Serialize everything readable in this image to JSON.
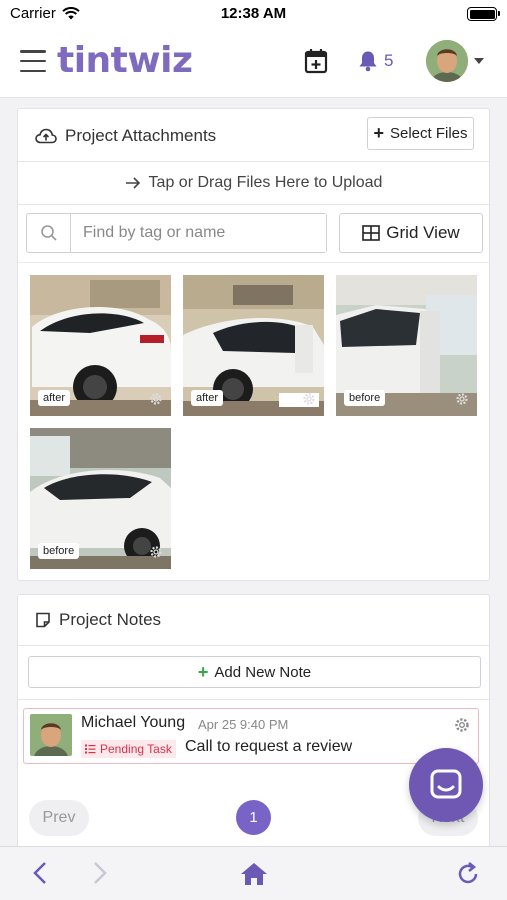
{
  "status_bar": {
    "carrier": "Carrier",
    "time": "12:38 AM"
  },
  "header": {
    "logo": "tintwiz",
    "notification_count": "5"
  },
  "attachments": {
    "title": "Project Attachments",
    "select_files_label": "Select Files",
    "dropzone_text": "Tap or Drag Files Here to Upload",
    "search_placeholder": "Find by tag or name",
    "grid_view_label": "Grid View",
    "photos": [
      {
        "tag": "after"
      },
      {
        "tag": "after"
      },
      {
        "tag": "before"
      },
      {
        "tag": "before"
      }
    ]
  },
  "notes": {
    "title": "Project Notes",
    "add_label": "Add New Note",
    "items": [
      {
        "author": "Michael Young",
        "date": "Apr 25 9:40 PM",
        "badge": "Pending Task",
        "text": "Call to request a review"
      }
    ]
  },
  "pagination": {
    "prev": "Prev",
    "current": "1",
    "next": "Next"
  },
  "colors": {
    "brand": "#7e6bbf",
    "accent": "#6e58b4",
    "pending": "#d9314c",
    "add_plus": "#2eaa4a"
  }
}
